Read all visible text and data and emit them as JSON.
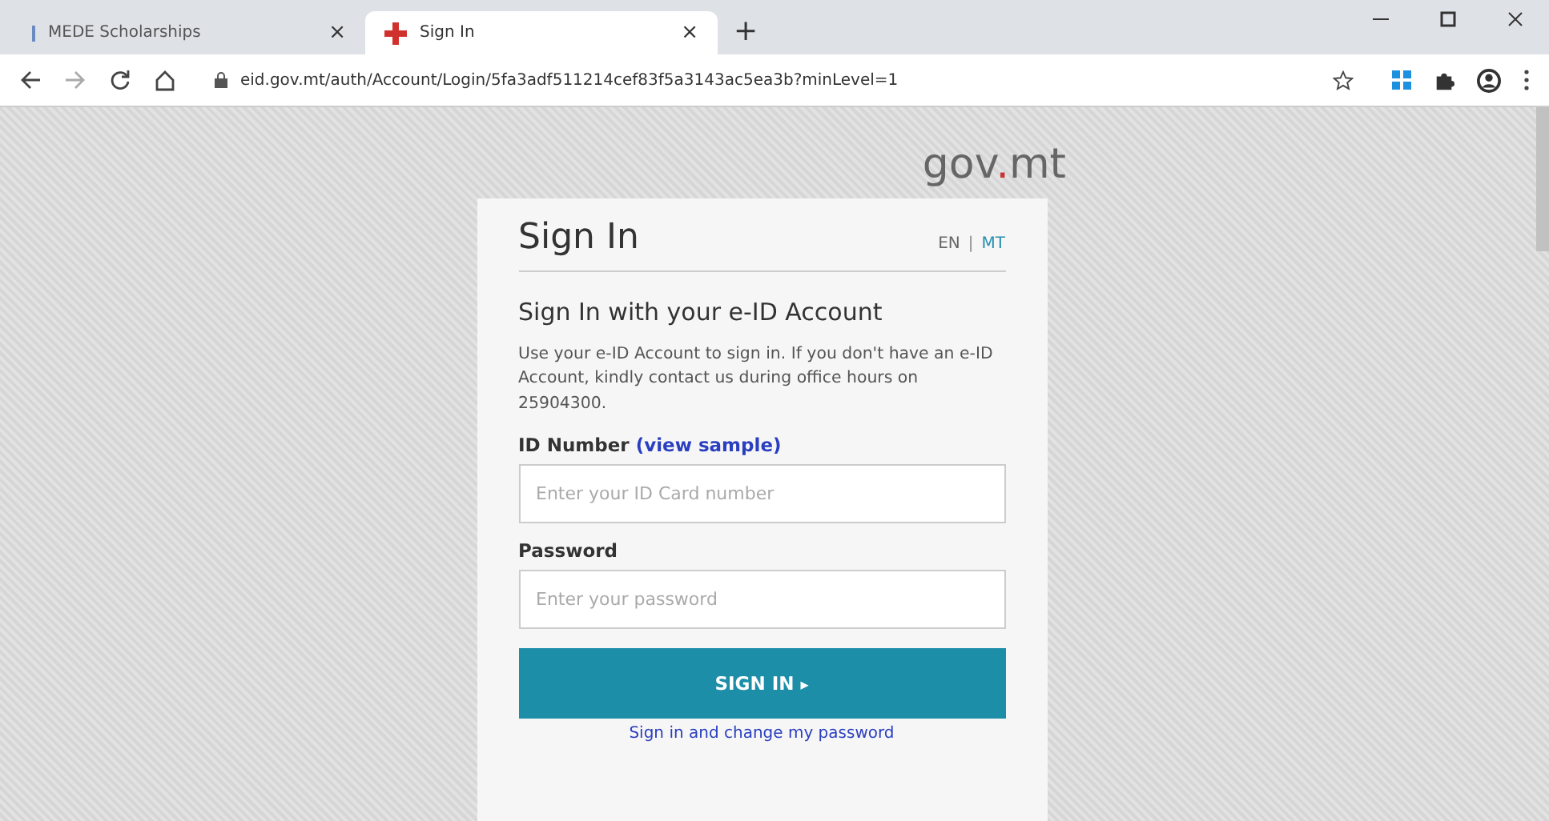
{
  "browser": {
    "tabs": [
      {
        "title": "MEDE Scholarships",
        "selected": false,
        "close": "×"
      },
      {
        "title": "Sign In",
        "selected": true,
        "close": "×"
      }
    ],
    "new_tab": "+",
    "url": "eid.gov.mt/auth/Account/Login/5fa3adf511214cef83f5a3143ac5ea3b?minLevel=1"
  },
  "logo": {
    "text": "gov",
    "dot": ".",
    "suffix": "mt"
  },
  "card": {
    "title": "Sign In",
    "languages": [
      {
        "label": "EN",
        "selected": true
      },
      {
        "label": "MT",
        "selected": false
      }
    ],
    "lang_separator": "|",
    "subtitle": "Sign In with your e-ID Account",
    "intro": "Use your e-ID Account to sign in. If you don't have an e-ID Account, kindly contact us during office hours on 25904300.",
    "fields": [
      {
        "label": "ID Number",
        "link": "(view sample)",
        "placeholder": "Enter your ID Card number"
      },
      {
        "label": "Password",
        "placeholder": "Enter your password"
      }
    ],
    "button": {
      "label": "SIGN IN",
      "arrow": "▸"
    },
    "footer_link": "Sign in and change my password"
  }
}
